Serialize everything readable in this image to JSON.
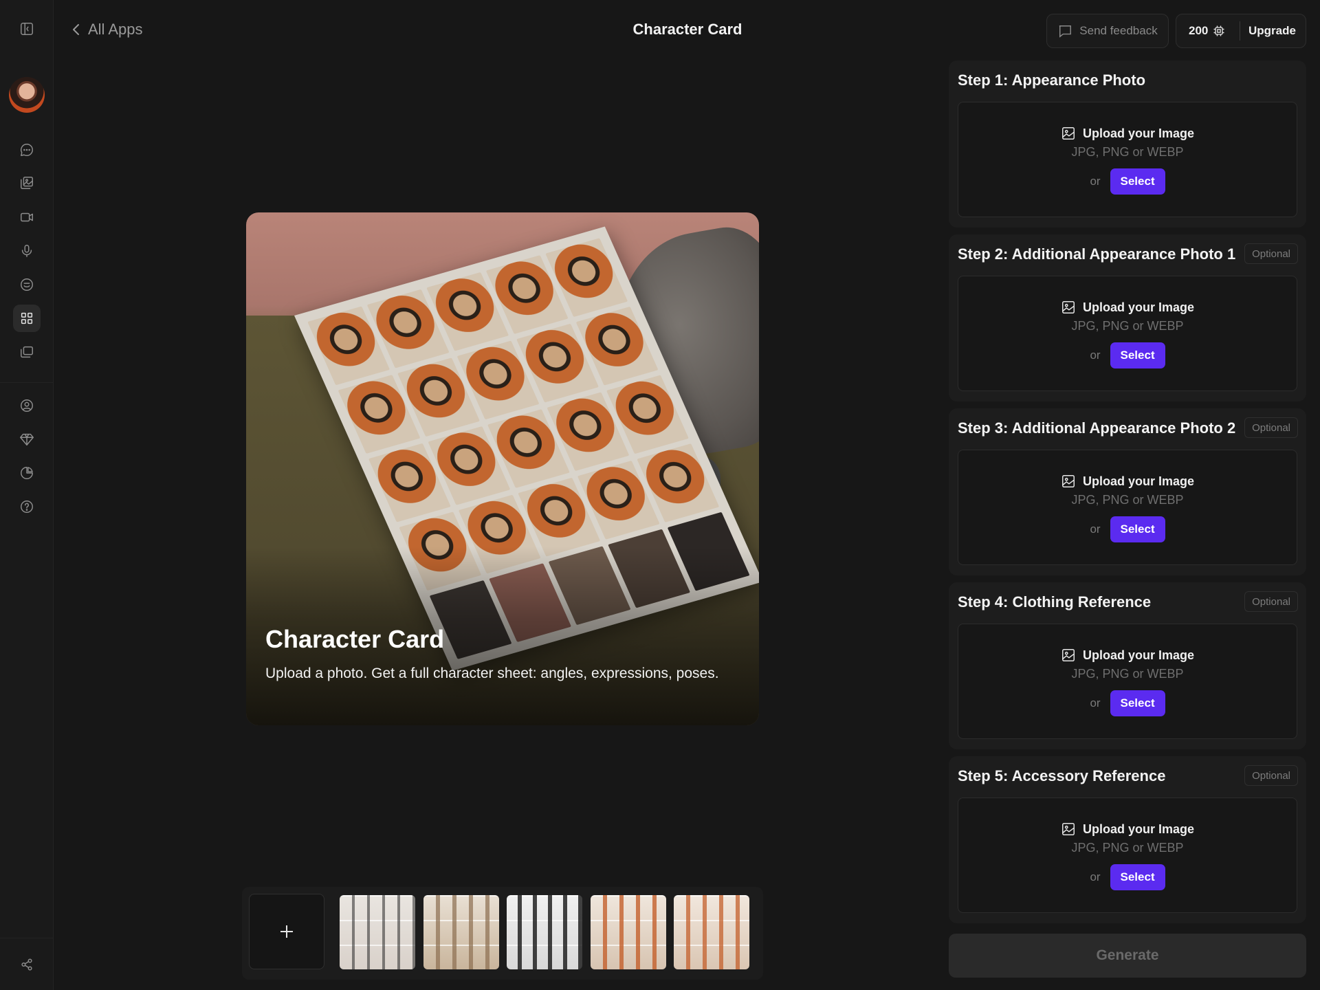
{
  "header": {
    "back_label": "All Apps",
    "title": "Character Card",
    "feedback_label": "Send feedback",
    "credits": "200",
    "upgrade_label": "Upgrade"
  },
  "sidebar": {
    "icons": [
      "sidebar-toggle-icon",
      "chat-icon",
      "image-gallery-icon",
      "video-icon",
      "microphone-icon",
      "emoji-icon",
      "apps-grid-icon",
      "library-icon",
      "user-circle-icon",
      "diamond-icon",
      "usage-chart-icon",
      "help-icon",
      "share-icon"
    ],
    "active_icon": "apps-grid-icon"
  },
  "hero": {
    "title": "Character Card",
    "description": "Upload a photo. Get a full character sheet: angles, expressions, poses."
  },
  "steps": [
    {
      "title": "Step 1: Appearance Photo",
      "optional": "",
      "upload_label": "Upload your Image",
      "formats": "JPG, PNG or WEBP",
      "or_label": "or",
      "select_label": "Select"
    },
    {
      "title": "Step 2: Additional Appearance Photo 1",
      "optional": "Optional",
      "upload_label": "Upload your Image",
      "formats": "JPG, PNG or WEBP",
      "or_label": "or",
      "select_label": "Select"
    },
    {
      "title": "Step 3: Additional Appearance Photo 2",
      "optional": "Optional",
      "upload_label": "Upload your Image",
      "formats": "JPG, PNG or WEBP",
      "or_label": "or",
      "select_label": "Select"
    },
    {
      "title": "Step 4: Clothing Reference",
      "optional": "Optional",
      "upload_label": "Upload your Image",
      "formats": "JPG, PNG or WEBP",
      "or_label": "or",
      "select_label": "Select"
    },
    {
      "title": "Step 5: Accessory Reference",
      "optional": "Optional",
      "upload_label": "Upload your Image",
      "formats": "JPG, PNG or WEBP",
      "or_label": "or",
      "select_label": "Select"
    }
  ],
  "generate_label": "Generate",
  "colors": {
    "background": "#171717",
    "accent": "#5b2bf0",
    "panel": "#1d1d1d"
  }
}
